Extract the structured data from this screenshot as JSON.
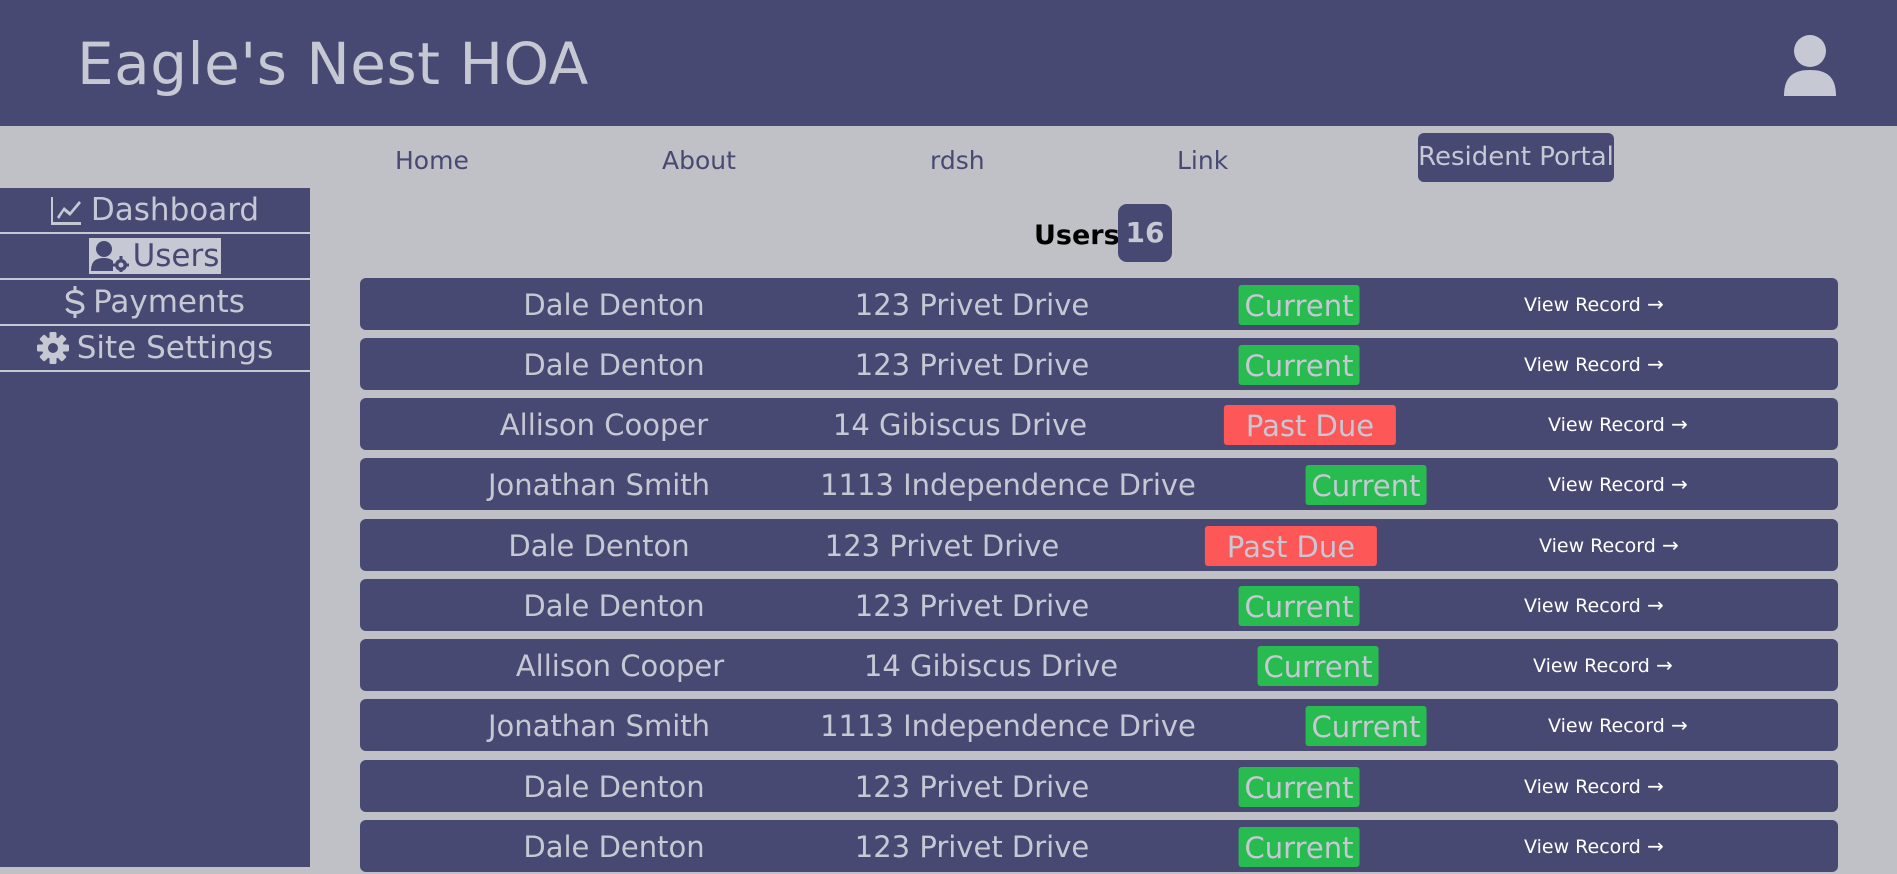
{
  "header": {
    "title": "Eagle's Nest HOA",
    "user_icon": "user-avatar-icon"
  },
  "nav": {
    "links": [
      "Home",
      "About",
      "rdsh",
      "Link"
    ],
    "portal": "Resident Portal"
  },
  "sidebar": {
    "items": [
      {
        "label": "Dashboard",
        "icon": "chart-line-icon"
      },
      {
        "label": "Users",
        "icon": "user-gear-icon",
        "active": true
      },
      {
        "label": "Payments",
        "icon": "dollar-icon"
      },
      {
        "label": "Site Settings",
        "icon": "gear-icon"
      }
    ]
  },
  "users": {
    "heading": "Users",
    "count": "16",
    "view_label": "View Record",
    "rows": [
      {
        "name": "Dale Denton",
        "address": "123 Privet Drive",
        "status": "Current"
      },
      {
        "name": "Dale Denton",
        "address": "123 Privet Drive",
        "status": "Current"
      },
      {
        "name": "Allison Cooper",
        "address": "14 Gibiscus Drive",
        "status": "Past Due"
      },
      {
        "name": "Jonathan Smith",
        "address": "1113 Independence Drive",
        "status": "Current"
      },
      {
        "name": "Dale Denton",
        "address": "123 Privet Drive",
        "status": "Past Due"
      },
      {
        "name": "Dale Denton",
        "address": "123 Privet Drive",
        "status": "Current"
      },
      {
        "name": "Allison Cooper",
        "address": "14 Gibiscus Drive",
        "status": "Current"
      },
      {
        "name": "Jonathan Smith",
        "address": "1113 Independence Drive",
        "status": "Current"
      },
      {
        "name": "Dale Denton",
        "address": "123 Privet Drive",
        "status": "Current"
      },
      {
        "name": "Dale Denton",
        "address": "123 Privet Drive",
        "status": "Current"
      }
    ]
  },
  "colors": {
    "primary": "#484972",
    "background": "#bfc1c7",
    "text_light": "#c6c8d4",
    "current": "#28bb4f",
    "past_due": "#fe5757"
  }
}
